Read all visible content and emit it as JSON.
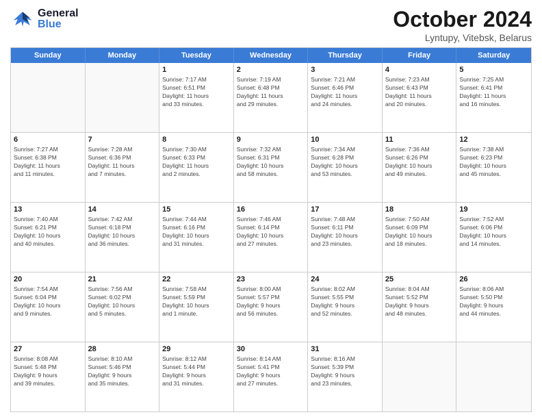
{
  "header": {
    "logo_general": "General",
    "logo_blue": "Blue",
    "month_title": "October 2024",
    "location": "Lyntupy, Vitebsk, Belarus"
  },
  "weekdays": [
    "Sunday",
    "Monday",
    "Tuesday",
    "Wednesday",
    "Thursday",
    "Friday",
    "Saturday"
  ],
  "rows": [
    [
      {
        "day": "",
        "info": ""
      },
      {
        "day": "",
        "info": ""
      },
      {
        "day": "1",
        "info": "Sunrise: 7:17 AM\nSunset: 6:51 PM\nDaylight: 11 hours\nand 33 minutes."
      },
      {
        "day": "2",
        "info": "Sunrise: 7:19 AM\nSunset: 6:48 PM\nDaylight: 11 hours\nand 29 minutes."
      },
      {
        "day": "3",
        "info": "Sunrise: 7:21 AM\nSunset: 6:46 PM\nDaylight: 11 hours\nand 24 minutes."
      },
      {
        "day": "4",
        "info": "Sunrise: 7:23 AM\nSunset: 6:43 PM\nDaylight: 11 hours\nand 20 minutes."
      },
      {
        "day": "5",
        "info": "Sunrise: 7:25 AM\nSunset: 6:41 PM\nDaylight: 11 hours\nand 16 minutes."
      }
    ],
    [
      {
        "day": "6",
        "info": "Sunrise: 7:27 AM\nSunset: 6:38 PM\nDaylight: 11 hours\nand 11 minutes."
      },
      {
        "day": "7",
        "info": "Sunrise: 7:28 AM\nSunset: 6:36 PM\nDaylight: 11 hours\nand 7 minutes."
      },
      {
        "day": "8",
        "info": "Sunrise: 7:30 AM\nSunset: 6:33 PM\nDaylight: 11 hours\nand 2 minutes."
      },
      {
        "day": "9",
        "info": "Sunrise: 7:32 AM\nSunset: 6:31 PM\nDaylight: 10 hours\nand 58 minutes."
      },
      {
        "day": "10",
        "info": "Sunrise: 7:34 AM\nSunset: 6:28 PM\nDaylight: 10 hours\nand 53 minutes."
      },
      {
        "day": "11",
        "info": "Sunrise: 7:36 AM\nSunset: 6:26 PM\nDaylight: 10 hours\nand 49 minutes."
      },
      {
        "day": "12",
        "info": "Sunrise: 7:38 AM\nSunset: 6:23 PM\nDaylight: 10 hours\nand 45 minutes."
      }
    ],
    [
      {
        "day": "13",
        "info": "Sunrise: 7:40 AM\nSunset: 6:21 PM\nDaylight: 10 hours\nand 40 minutes."
      },
      {
        "day": "14",
        "info": "Sunrise: 7:42 AM\nSunset: 6:18 PM\nDaylight: 10 hours\nand 36 minutes."
      },
      {
        "day": "15",
        "info": "Sunrise: 7:44 AM\nSunset: 6:16 PM\nDaylight: 10 hours\nand 31 minutes."
      },
      {
        "day": "16",
        "info": "Sunrise: 7:46 AM\nSunset: 6:14 PM\nDaylight: 10 hours\nand 27 minutes."
      },
      {
        "day": "17",
        "info": "Sunrise: 7:48 AM\nSunset: 6:11 PM\nDaylight: 10 hours\nand 23 minutes."
      },
      {
        "day": "18",
        "info": "Sunrise: 7:50 AM\nSunset: 6:09 PM\nDaylight: 10 hours\nand 18 minutes."
      },
      {
        "day": "19",
        "info": "Sunrise: 7:52 AM\nSunset: 6:06 PM\nDaylight: 10 hours\nand 14 minutes."
      }
    ],
    [
      {
        "day": "20",
        "info": "Sunrise: 7:54 AM\nSunset: 6:04 PM\nDaylight: 10 hours\nand 9 minutes."
      },
      {
        "day": "21",
        "info": "Sunrise: 7:56 AM\nSunset: 6:02 PM\nDaylight: 10 hours\nand 5 minutes."
      },
      {
        "day": "22",
        "info": "Sunrise: 7:58 AM\nSunset: 5:59 PM\nDaylight: 10 hours\nand 1 minute."
      },
      {
        "day": "23",
        "info": "Sunrise: 8:00 AM\nSunset: 5:57 PM\nDaylight: 9 hours\nand 56 minutes."
      },
      {
        "day": "24",
        "info": "Sunrise: 8:02 AM\nSunset: 5:55 PM\nDaylight: 9 hours\nand 52 minutes."
      },
      {
        "day": "25",
        "info": "Sunrise: 8:04 AM\nSunset: 5:52 PM\nDaylight: 9 hours\nand 48 minutes."
      },
      {
        "day": "26",
        "info": "Sunrise: 8:06 AM\nSunset: 5:50 PM\nDaylight: 9 hours\nand 44 minutes."
      }
    ],
    [
      {
        "day": "27",
        "info": "Sunrise: 8:08 AM\nSunset: 5:48 PM\nDaylight: 9 hours\nand 39 minutes."
      },
      {
        "day": "28",
        "info": "Sunrise: 8:10 AM\nSunset: 5:46 PM\nDaylight: 9 hours\nand 35 minutes."
      },
      {
        "day": "29",
        "info": "Sunrise: 8:12 AM\nSunset: 5:44 PM\nDaylight: 9 hours\nand 31 minutes."
      },
      {
        "day": "30",
        "info": "Sunrise: 8:14 AM\nSunset: 5:41 PM\nDaylight: 9 hours\nand 27 minutes."
      },
      {
        "day": "31",
        "info": "Sunrise: 8:16 AM\nSunset: 5:39 PM\nDaylight: 9 hours\nand 23 minutes."
      },
      {
        "day": "",
        "info": ""
      },
      {
        "day": "",
        "info": ""
      }
    ]
  ]
}
